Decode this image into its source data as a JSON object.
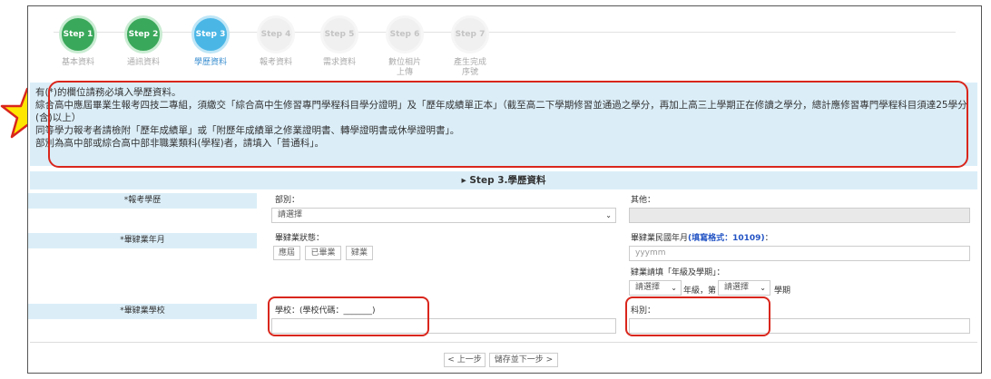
{
  "steps": [
    {
      "badge": "Step 1",
      "label": "基本資料",
      "state": "done"
    },
    {
      "badge": "Step 2",
      "label": "通訊資料",
      "state": "done"
    },
    {
      "badge": "Step 3",
      "label": "學歷資料",
      "state": "current"
    },
    {
      "badge": "Step 4",
      "label": "報考資料",
      "state": "todo"
    },
    {
      "badge": "Step 5",
      "label": "需求資料",
      "state": "todo"
    },
    {
      "badge": "Step 6",
      "label": "數位相片\n上傳",
      "state": "todo"
    },
    {
      "badge": "Step 7",
      "label": "產生完成\n序號",
      "state": "todo"
    }
  ],
  "notice": {
    "line1": "有(*)的欄位請務必填入學歷資料。",
    "line2": "綜合高中應屆畢業生報考四技二專組，須繳交「綜合高中生修習專門學程科目學分證明」及「歷年成績單正本」（截至高二下學期修習並通過之學分，再加上高三上學期正在修讀之學分，總計應修習專門學程科目須達25學分(含)以上）",
    "line3": "同等學力報考者請檢附「歷年成績單」或「附歷年成績單之修業證明書、轉學證明書或休學證明書」。",
    "line4": "部別為高中部或綜合高中部非職業類科(學程)者，請填入「普通科」。"
  },
  "section": {
    "title": "▸ Step 3.學歷資料"
  },
  "form": {
    "exam_label": "*報考學歷",
    "division_label": "部別：",
    "division_value": "請選擇",
    "other_label": "其他：",
    "grad_label": "*畢肄業年月",
    "status_label": "畢肄業狀態：",
    "status_options": [
      "應屆",
      "已畢業",
      "肄業"
    ],
    "date_label_prefix": "畢肄業民國年月",
    "date_label_hint": "(填寫格式：10109)",
    "date_label_suffix": "：",
    "date_placeholder": "yyymm",
    "drop_label": "肄業請填「年級及學期」：",
    "grade_value": "請選擇",
    "grade_text": "年級，第",
    "term_value": "請選擇",
    "term_text": "學期",
    "school_label": "*畢肄業學校",
    "school_field_label": "學校：(學校代碼：_______)",
    "dept_label": "科別："
  },
  "nav": {
    "prev": "< 上一步",
    "next": "儲存並下一步 >"
  },
  "colors": {
    "done": "#3aa85a",
    "current": "#4ab6e6",
    "highlight": "#d9261c",
    "notice_bg": "#dbeef8"
  }
}
